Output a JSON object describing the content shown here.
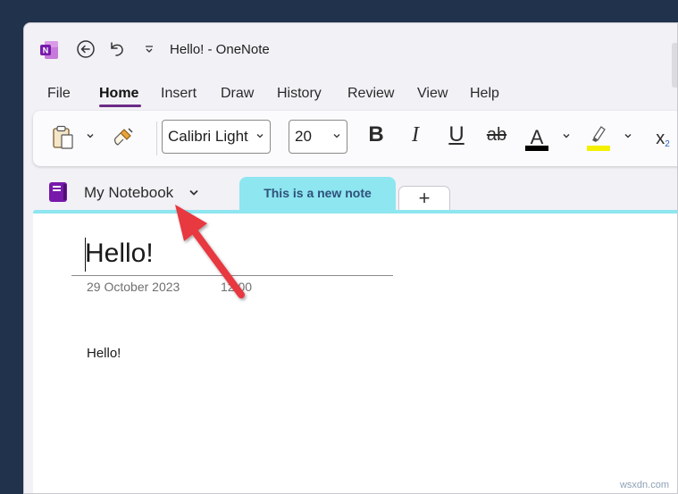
{
  "titlebar": {
    "title": "Hello!  -  OneNote"
  },
  "menu": {
    "items": [
      {
        "label": "File"
      },
      {
        "label": "Home"
      },
      {
        "label": "Insert"
      },
      {
        "label": "Draw"
      },
      {
        "label": "History"
      },
      {
        "label": "Review"
      },
      {
        "label": "View"
      },
      {
        "label": "Help"
      }
    ],
    "active": "Home"
  },
  "ribbon": {
    "font_family": "Calibri Light",
    "font_size": "20",
    "bold": "B",
    "italic": "I",
    "underline": "U",
    "strike": "ab",
    "font_color_glyph": "A",
    "subscript": "x",
    "subscript_index": "2",
    "colors": {
      "font_color": "#000000",
      "highlight": "#f3f000"
    }
  },
  "notebook": {
    "name": "My Notebook",
    "tabs": [
      {
        "label": "This is a new note",
        "active": true
      }
    ],
    "add_tab": "+",
    "accent": "#8de6f0"
  },
  "page": {
    "title": "Hello!",
    "date": "29 October 2023",
    "time": "12:00",
    "body": "Hello!"
  },
  "watermark": "wsxdn.com",
  "colors": {
    "brand": "#7b2fa8",
    "annotation_arrow": "#e8373f"
  }
}
